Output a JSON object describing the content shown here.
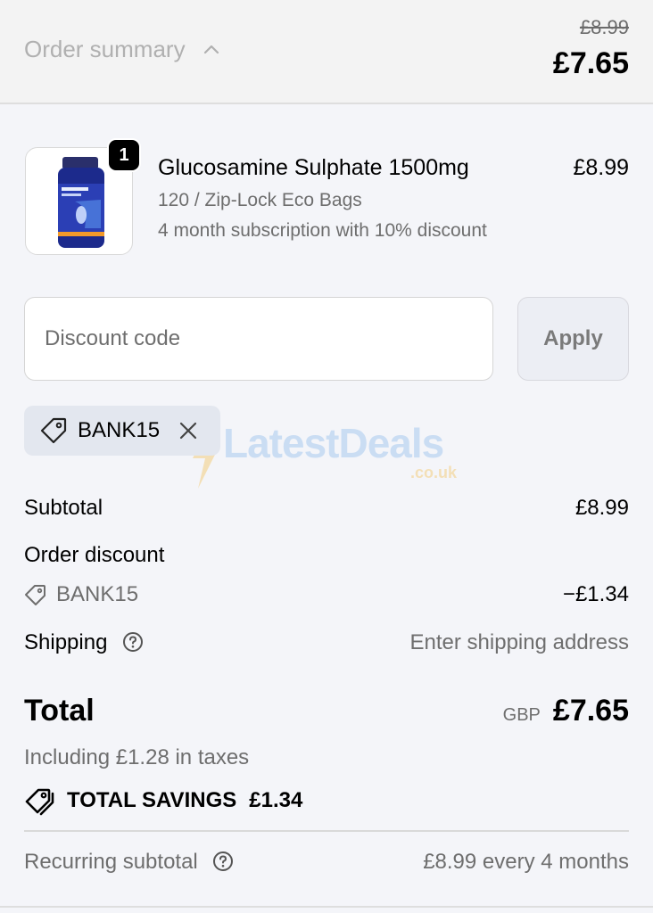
{
  "header": {
    "summary_label": "Order summary",
    "original_price": "£8.99",
    "total": "£7.65"
  },
  "product": {
    "quantity": "1",
    "name": "Glucosamine Sulphate 1500mg",
    "variant": "120 / Zip-Lock Eco Bags",
    "subscription": "4 month subscription with 10% discount",
    "price": "£8.99",
    "image_icon": "supplement-bottle-image"
  },
  "discount": {
    "placeholder": "Discount code",
    "value": "",
    "apply_label": "Apply",
    "applied_code": "BANK15"
  },
  "watermark": {
    "text": "LatestDeals",
    "subtext": ".co.uk"
  },
  "breakdown": {
    "subtotal_label": "Subtotal",
    "subtotal_value": "£8.99",
    "order_discount_label": "Order discount",
    "discount_code": "BANK15",
    "discount_value": "−£1.34",
    "shipping_label": "Shipping",
    "shipping_value": "Enter shipping address"
  },
  "total": {
    "label": "Total",
    "currency": "GBP",
    "value": "£7.65",
    "taxes": "Including £1.28 in taxes",
    "savings_label": "TOTAL SAVINGS",
    "savings_value": "£1.34"
  },
  "recurring": {
    "label": "Recurring subtotal",
    "value": "£8.99 every 4 months"
  },
  "colors": {
    "background": "#f4f5f9",
    "header_background": "#f3f3f3",
    "chip_background": "#e3e7ef",
    "muted_text": "#6e6e6e"
  }
}
